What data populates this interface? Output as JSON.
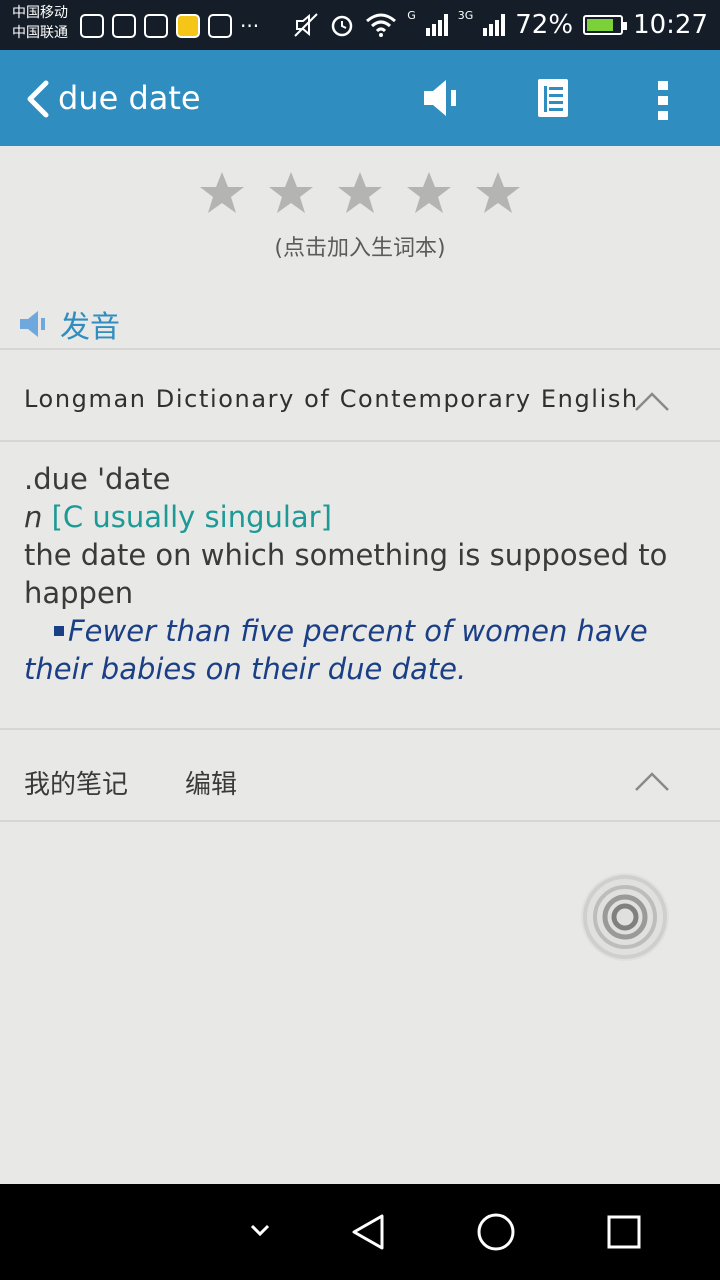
{
  "status_bar": {
    "carrier_1": "中国移动",
    "carrier_2": "中国联通",
    "network_1": "G",
    "network_2": "3G",
    "battery": "72%",
    "time": "10:27"
  },
  "app_bar": {
    "title": "due date",
    "icons": [
      "back-icon",
      "speaker-icon",
      "document-icon",
      "more-icon"
    ],
    "color": "#2f8dc0"
  },
  "rating": {
    "stars": 5,
    "filled": 0,
    "hint": "(点击加入生词本)"
  },
  "pronunciation": {
    "label": "发音"
  },
  "dictionary": {
    "title": "Longman Dictionary of Contemporary English",
    "headword": ".due 'date",
    "pos": "n",
    "grammar": "[C usually singular]",
    "definition": "the date on which something is supposed to happen",
    "example": "Fewer than five percent of women have their babies on their due date."
  },
  "notes": {
    "label": "我的笔记",
    "edit": "编辑"
  },
  "colors": {
    "accent": "#2f8dc0",
    "grammar": "#1e9a96",
    "example": "#1a3f86",
    "background": "#e8e8e6"
  }
}
